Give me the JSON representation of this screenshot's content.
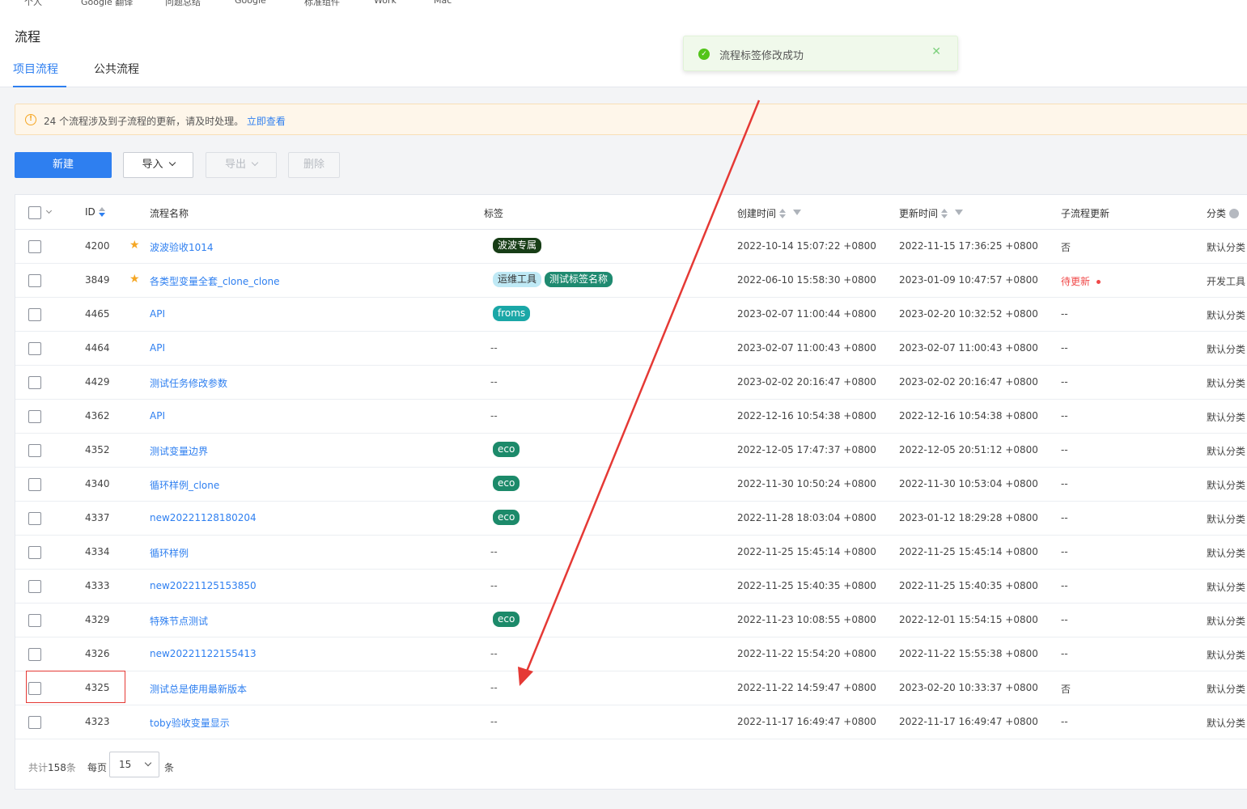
{
  "bookmarks": [
    "个人",
    "Google 翻译",
    "问题总结",
    "Google",
    "标准组件",
    "Work",
    "Mac"
  ],
  "page": {
    "title": "流程"
  },
  "tabs": [
    {
      "label": "项目流程",
      "active": true
    },
    {
      "label": "公共流程",
      "active": false
    }
  ],
  "toast": {
    "message": "流程标签修改成功",
    "status": "success"
  },
  "notice": {
    "text": "24 个流程涉及到子流程的更新，请及时处理。",
    "link": "立即查看"
  },
  "toolbar": {
    "new_label": "新建",
    "import_label": "导入",
    "export_label": "导出",
    "delete_label": "删除"
  },
  "table": {
    "columns": {
      "id": "ID",
      "name": "流程名称",
      "tags": "标签",
      "created": "创建时间",
      "updated": "更新时间",
      "sub": "子流程更新",
      "category": "分类"
    },
    "rows": [
      {
        "id": "4200",
        "starred": true,
        "name": "波波验收1014",
        "tags": [
          {
            "text": "波波专属",
            "color": "#173d16"
          }
        ],
        "created": "2022-10-14 15:07:22 +0800",
        "updated": "2022-11-15 17:36:25 +0800",
        "sub": "否",
        "category": "默认分类"
      },
      {
        "id": "3849",
        "starred": true,
        "name": "各类型变量全套_clone_clone",
        "tags": [
          {
            "text": "运维工具",
            "color": "#bfe9f5",
            "text_color": "#333333"
          },
          {
            "text": "测试标签名称",
            "color": "#1f8a70"
          }
        ],
        "created": "2022-06-10 15:58:30 +0800",
        "updated": "2023-01-09 10:47:57 +0800",
        "sub": "待更新",
        "sub_pending": true,
        "category": "开发工具"
      },
      {
        "id": "4465",
        "name": "API",
        "tags": [
          {
            "text": "froms",
            "color": "#1aa7a7"
          }
        ],
        "created": "2023-02-07 11:00:44 +0800",
        "updated": "2023-02-20 10:32:52 +0800",
        "sub": "--",
        "category": "默认分类"
      },
      {
        "id": "4464",
        "name": "API",
        "tags": [],
        "created": "2023-02-07 11:00:43 +0800",
        "updated": "2023-02-07 11:00:43 +0800",
        "sub": "--",
        "category": "默认分类"
      },
      {
        "id": "4429",
        "name": "测试任务修改参数",
        "tags": [],
        "created": "2023-02-02 20:16:47 +0800",
        "updated": "2023-02-02 20:16:47 +0800",
        "sub": "--",
        "category": "默认分类"
      },
      {
        "id": "4362",
        "name": "API",
        "tags": [],
        "created": "2022-12-16 10:54:38 +0800",
        "updated": "2022-12-16 10:54:38 +0800",
        "sub": "--",
        "category": "默认分类"
      },
      {
        "id": "4352",
        "name": "测试变量边界",
        "tags": [
          {
            "text": "eco",
            "color": "#1c8a6a"
          }
        ],
        "created": "2022-12-05 17:47:37 +0800",
        "updated": "2022-12-05 20:51:12 +0800",
        "sub": "--",
        "category": "默认分类"
      },
      {
        "id": "4340",
        "name": "循环样例_clone",
        "tags": [
          {
            "text": "eco",
            "color": "#1c8a6a"
          }
        ],
        "created": "2022-11-30 10:50:24 +0800",
        "updated": "2022-11-30 10:53:04 +0800",
        "sub": "--",
        "category": "默认分类"
      },
      {
        "id": "4337",
        "name": "new20221128180204",
        "tags": [
          {
            "text": "eco",
            "color": "#1c8a6a"
          }
        ],
        "created": "2022-11-28 18:03:04 +0800",
        "updated": "2023-01-12 18:29:28 +0800",
        "sub": "--",
        "category": "默认分类"
      },
      {
        "id": "4334",
        "name": "循环样例",
        "tags": [],
        "created": "2022-11-25 15:45:14 +0800",
        "updated": "2022-11-25 15:45:14 +0800",
        "sub": "--",
        "category": "默认分类"
      },
      {
        "id": "4333",
        "name": "new20221125153850",
        "tags": [],
        "created": "2022-11-25 15:40:35 +0800",
        "updated": "2022-11-25 15:40:35 +0800",
        "sub": "--",
        "category": "默认分类"
      },
      {
        "id": "4329",
        "name": "特殊节点测试",
        "tags": [
          {
            "text": "eco",
            "color": "#1c8a6a"
          }
        ],
        "created": "2022-11-23 10:08:55 +0800",
        "updated": "2022-12-01 15:54:15 +0800",
        "sub": "--",
        "category": "默认分类"
      },
      {
        "id": "4326",
        "name": "new20221122155413",
        "tags": [],
        "created": "2022-11-22 15:54:20 +0800",
        "updated": "2022-11-22 15:55:38 +0800",
        "sub": "--",
        "category": "默认分类"
      },
      {
        "id": "4325",
        "name": "测试总是使用最新版本",
        "tags": [],
        "created": "2022-11-22 14:59:47 +0800",
        "updated": "2023-02-20 10:33:37 +0800",
        "sub": "否",
        "category": "默认分类"
      },
      {
        "id": "4323",
        "name": "toby验收变量显示",
        "tags": [],
        "created": "2022-11-17 16:49:47 +0800",
        "updated": "2022-11-17 16:49:47 +0800",
        "sub": "--",
        "category": "默认分类"
      }
    ],
    "empty": "--"
  },
  "pagination": {
    "total_prefix": "共计",
    "total": "158",
    "total_suffix": "条",
    "per_page_prefix": "每页",
    "per_page": "15",
    "per_page_suffix": "条"
  }
}
